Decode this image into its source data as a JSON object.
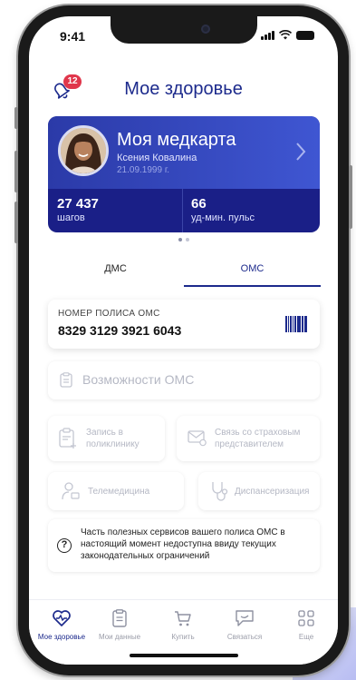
{
  "status_bar": {
    "time": "9:41"
  },
  "header": {
    "title": "Мое здоровье",
    "notifications_count": "12"
  },
  "medcard": {
    "title": "Моя медкарта",
    "name": "Ксения Ковалина",
    "birth_date": "21.09.1999 г.",
    "stats": [
      {
        "value": "27 437",
        "label": "шагов"
      },
      {
        "value": "66",
        "label": "уд-мин. пульс"
      }
    ]
  },
  "tabs": [
    {
      "label": "ДМС",
      "active": false
    },
    {
      "label": "ОМС",
      "active": true
    }
  ],
  "policy": {
    "label": "НОМЕР ПОЛИСА ОМС",
    "number": "8329 3129 3921 6043"
  },
  "services": {
    "possibilities": "Возможности ОМС",
    "clinic_appointment": "Запись в поликлинику",
    "insurer_contact": "Связь со страховым представителем",
    "telemedicine": "Телемедицина",
    "dispensary": "Диспансеризация"
  },
  "info": {
    "icon": "question-icon",
    "text": "Часть полезных сервисов вашего полиса ОМС в настоящий момент недоступна ввиду текущих законодательных ограничений"
  },
  "tabbar": [
    {
      "label": "Мое здоровье",
      "icon": "heart-pulse-icon",
      "active": true
    },
    {
      "label": "Мои данные",
      "icon": "document-icon",
      "active": false
    },
    {
      "label": "Купить",
      "icon": "cart-icon",
      "active": false
    },
    {
      "label": "Связаться",
      "icon": "chat-icon",
      "active": false
    },
    {
      "label": "Еще",
      "icon": "grid-icon",
      "active": false
    }
  ],
  "colors": {
    "brand": "#1c2a8c",
    "card_blue": "#3f56d2",
    "badge": "#e0364b",
    "disabled_text": "#b5b8c4"
  }
}
